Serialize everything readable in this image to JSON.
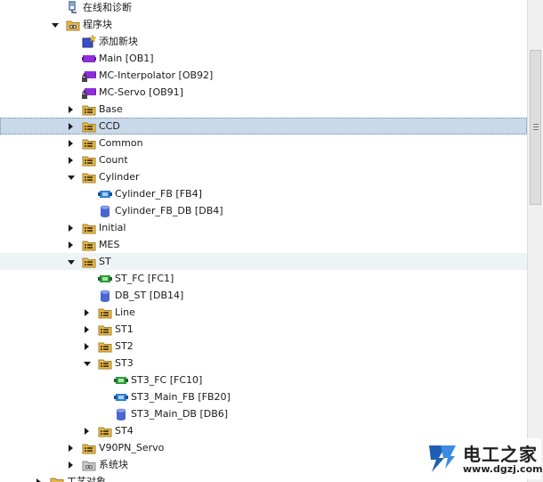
{
  "tree": {
    "items": [
      {
        "label": "在线和诊断",
        "icon": "online-diagnostics-icon",
        "level": 0,
        "expander": "none",
        "state": ""
      },
      {
        "label": "程序块",
        "icon": "program-blocks-folder-icon",
        "level": 0,
        "expander": "open",
        "state": ""
      },
      {
        "label": "添加新块",
        "icon": "add-new-block-icon",
        "level": 1,
        "expander": "none",
        "state": ""
      },
      {
        "label": "Main [OB1]",
        "icon": "ob-block-icon",
        "level": 1,
        "expander": "none",
        "state": ""
      },
      {
        "label": "MC-Interpolator [OB92]",
        "icon": "ob-block-locked-icon",
        "level": 1,
        "expander": "none",
        "state": ""
      },
      {
        "label": "MC-Servo [OB91]",
        "icon": "ob-block-locked-icon",
        "level": 1,
        "expander": "none",
        "state": ""
      },
      {
        "label": "Base",
        "icon": "folder-icon",
        "level": 1,
        "expander": "closed",
        "state": ""
      },
      {
        "label": "CCD",
        "icon": "folder-icon",
        "level": 1,
        "expander": "closed",
        "state": "selected"
      },
      {
        "label": "Common",
        "icon": "folder-icon",
        "level": 1,
        "expander": "closed",
        "state": ""
      },
      {
        "label": "Count",
        "icon": "folder-icon",
        "level": 1,
        "expander": "closed",
        "state": ""
      },
      {
        "label": "Cylinder",
        "icon": "folder-icon",
        "level": 1,
        "expander": "open",
        "state": ""
      },
      {
        "label": "Cylinder_FB [FB4]",
        "icon": "fb-block-icon",
        "level": 2,
        "expander": "none",
        "state": ""
      },
      {
        "label": "Cylinder_FB_DB [DB4]",
        "icon": "db-block-icon",
        "level": 2,
        "expander": "none",
        "state": ""
      },
      {
        "label": "Initial",
        "icon": "folder-icon",
        "level": 1,
        "expander": "closed",
        "state": ""
      },
      {
        "label": "MES",
        "icon": "folder-icon",
        "level": 1,
        "expander": "closed",
        "state": ""
      },
      {
        "label": "ST",
        "icon": "folder-icon",
        "level": 1,
        "expander": "open",
        "state": "hover"
      },
      {
        "label": "ST_FC [FC1]",
        "icon": "fc-block-icon",
        "level": 2,
        "expander": "none",
        "state": ""
      },
      {
        "label": "DB_ST [DB14]",
        "icon": "db-block-icon",
        "level": 2,
        "expander": "none",
        "state": ""
      },
      {
        "label": "Line",
        "icon": "folder-icon",
        "level": 2,
        "expander": "closed",
        "state": ""
      },
      {
        "label": "ST1",
        "icon": "folder-icon",
        "level": 2,
        "expander": "closed",
        "state": ""
      },
      {
        "label": "ST2",
        "icon": "folder-icon",
        "level": 2,
        "expander": "closed",
        "state": ""
      },
      {
        "label": "ST3",
        "icon": "folder-icon",
        "level": 2,
        "expander": "open",
        "state": ""
      },
      {
        "label": "ST3_FC [FC10]",
        "icon": "fc-block-icon",
        "level": 3,
        "expander": "none",
        "state": ""
      },
      {
        "label": "ST3_Main_FB [FB20]",
        "icon": "fb-block-icon",
        "level": 3,
        "expander": "none",
        "state": ""
      },
      {
        "label": "ST3_Main_DB [DB6]",
        "icon": "db-block-icon",
        "level": 3,
        "expander": "none",
        "state": ""
      },
      {
        "label": "ST4",
        "icon": "folder-icon",
        "level": 2,
        "expander": "closed",
        "state": ""
      },
      {
        "label": "V90PN_Servo",
        "icon": "folder-icon",
        "level": 1,
        "expander": "closed",
        "state": ""
      },
      {
        "label": "系统块",
        "icon": "system-blocks-folder-icon",
        "level": 1,
        "expander": "closed",
        "state": ""
      },
      {
        "label": "工艺对象",
        "icon": "technology-objects-folder-icon",
        "level": -1,
        "expander": "closed",
        "state": ""
      }
    ]
  },
  "watermark": {
    "title": "电工之家",
    "url": "www.dgzj.com"
  },
  "colors": {
    "folder": "#e3b84e",
    "ob_block": "#8c2fd6",
    "fb_block": "#2f7fd2",
    "fc_block": "#2e9a3a",
    "db_block": "#4a67d0",
    "selected_row": "#c9d9e9",
    "hover_row": "#eef3f6"
  }
}
